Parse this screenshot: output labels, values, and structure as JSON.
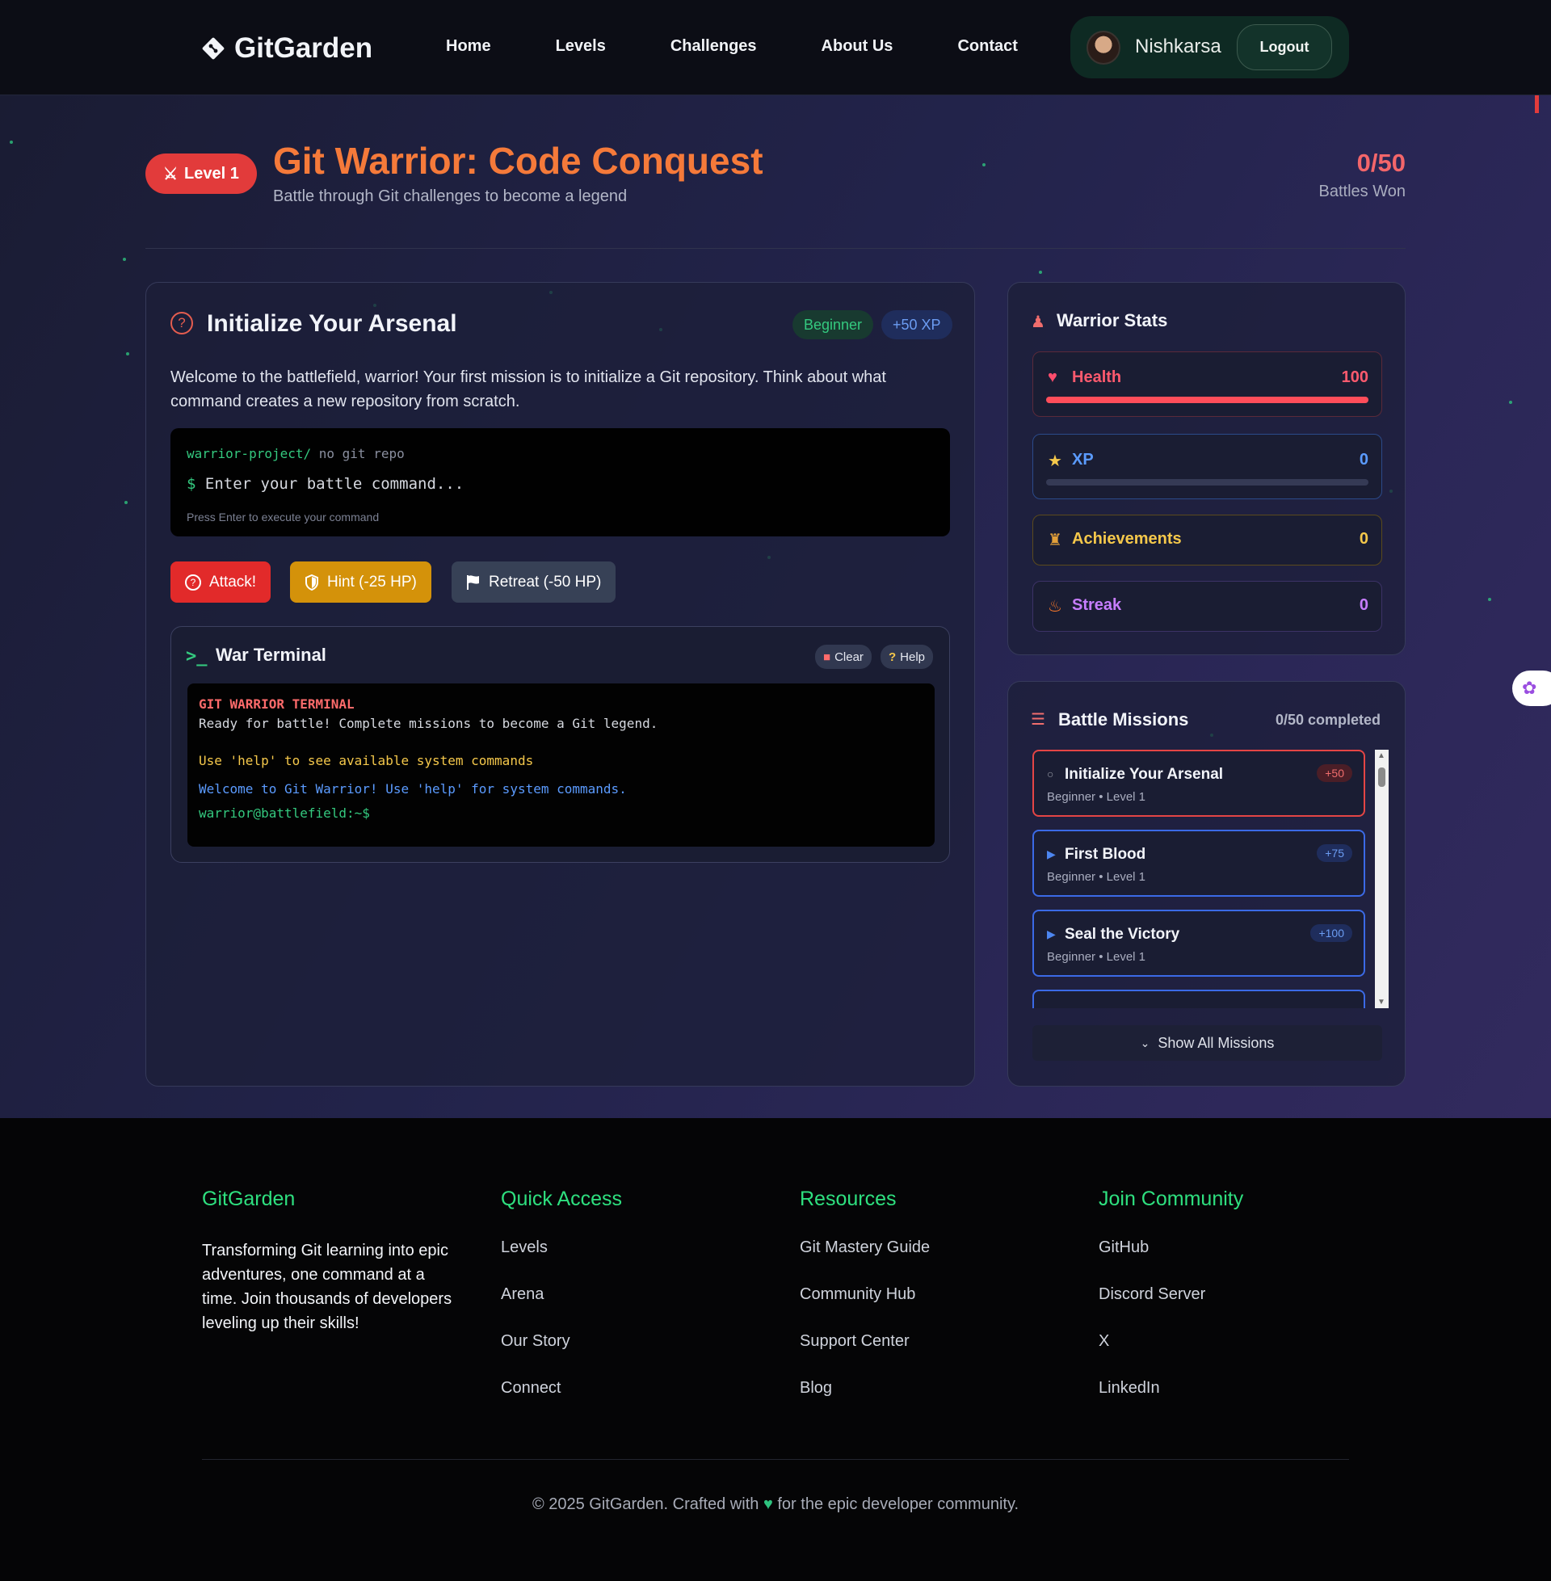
{
  "nav": {
    "brand": "GitGarden",
    "links": [
      "Home",
      "Levels",
      "Challenges",
      "About Us",
      "Contact"
    ],
    "user": "Nishkarsa",
    "logout": "Logout"
  },
  "header": {
    "level_badge": "Level 1",
    "title": "Git Warrior: Code Conquest",
    "subtitle": "Battle through Git challenges to become a legend",
    "score": "0/50",
    "score_label": "Battles Won"
  },
  "mission": {
    "title": "Initialize Your Arsenal",
    "difficulty": "Beginner",
    "xp": "+50 XP",
    "description": "Welcome to the battlefield, warrior! Your first mission is to initialize a Git repository. Think about what command creates a new repository from scratch.",
    "path": "warrior-project/",
    "repo_status": "no git repo",
    "prompt": "$",
    "input_placeholder": "Enter your battle command...",
    "input_hint": "Press Enter to execute your command"
  },
  "actions": {
    "attack": "Attack!",
    "hint": "Hint (-25 HP)",
    "retreat": "Retreat (-50 HP)"
  },
  "terminal": {
    "title": "War Terminal",
    "clear": "Clear",
    "help": "Help",
    "lines": [
      {
        "text": "GIT WARRIOR TERMINAL",
        "color": "#ff6b6b"
      },
      {
        "text": "Ready for battle! Complete missions to become a Git legend.",
        "color": "#d6d9e0"
      },
      {
        "text": "Use 'help' to see available system commands",
        "color": "#f5c84b"
      },
      {
        "text": "Welcome to Git Warrior! Use 'help' for system commands.",
        "color": "#5b9bff"
      },
      {
        "text": "warrior@battlefield:~$",
        "color": "#34c97f"
      }
    ]
  },
  "stats": {
    "title": "Warrior Stats",
    "items": [
      {
        "label": "Health",
        "value": "100",
        "icon": "heart-icon",
        "color": "#ff5a6e",
        "bar": 1.0
      },
      {
        "label": "XP",
        "value": "0",
        "icon": "star-icon",
        "color": "#5b9bff",
        "bar": 0.0
      },
      {
        "label": "Achievements",
        "value": "0",
        "icon": "trophy-icon",
        "color": "#f5c84b"
      },
      {
        "label": "Streak",
        "value": "0",
        "icon": "fire-icon",
        "color": "#c77dff"
      }
    ]
  },
  "missions_panel": {
    "title": "Battle Missions",
    "count": "0/50 completed",
    "items": [
      {
        "title": "Initialize Your Arsenal",
        "sub": "Beginner • Level 1",
        "xp": "+50",
        "active": true
      },
      {
        "title": "First Blood",
        "sub": "Beginner • Level 1",
        "xp": "+75",
        "active": false
      },
      {
        "title": "Seal the Victory",
        "sub": "Beginner • Level 1",
        "xp": "+100",
        "active": false
      }
    ],
    "show_all": "Show All Missions"
  },
  "footer": {
    "brand": "GitGarden",
    "tagline": "Transforming Git learning into epic adventures, one command at a time. Join thousands of developers leveling up their skills!",
    "quick_access": {
      "title": "Quick Access",
      "links": [
        "Levels",
        "Arena",
        "Our Story",
        "Connect"
      ]
    },
    "resources": {
      "title": "Resources",
      "links": [
        "Git Mastery Guide",
        "Community Hub",
        "Support Center",
        "Blog"
      ]
    },
    "community": {
      "title": "Join Community",
      "links": [
        "GitHub",
        "Discord Server",
        "X",
        "LinkedIn"
      ]
    },
    "copyright_pre": "© 2025 GitGarden. Crafted with",
    "copyright_post": "for the epic developer community."
  }
}
